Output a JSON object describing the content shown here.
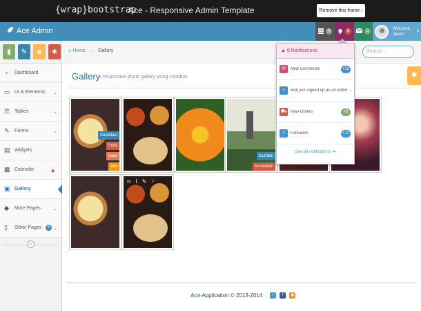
{
  "wrap_bar": {
    "logo": "{wrap}bootstrap",
    "title": "Ace - Responsive Admin Template",
    "remove_button": "Remove this frame ›"
  },
  "navbar": {
    "brand": "Ace Admin",
    "tasks_count": "4",
    "notifications_count": "8",
    "messages_count": "5",
    "user_greeting": "Welcome,",
    "user_name": "Jason"
  },
  "sidebar": {
    "items": [
      {
        "label": "Dashboard",
        "icon": "tachometer-icon"
      },
      {
        "label": "UI & Elements",
        "icon": "desktop-icon"
      },
      {
        "label": "Tables",
        "icon": "list-icon"
      },
      {
        "label": "Forms",
        "icon": "pencil-square-icon"
      },
      {
        "label": "Widgets",
        "icon": "list-alt-icon"
      },
      {
        "label": "Calendar",
        "icon": "calendar-icon"
      },
      {
        "label": "Gallery",
        "icon": "picture-icon"
      },
      {
        "label": "More Pages",
        "icon": "tag-icon"
      },
      {
        "label": "Other Pages",
        "icon": "file-icon",
        "badge": "5"
      }
    ]
  },
  "breadcrumb": {
    "home": "Home",
    "current": "Gallery",
    "search_placeholder": "Search ..."
  },
  "page": {
    "title": "Gallery",
    "subtitle": "» responsive photo gallery using colorbox"
  },
  "gallery": {
    "tags": [
      "breakfast",
      "fruits",
      "toast",
      "diet"
    ],
    "tags2": [
      "fountain",
      "recreation"
    ]
  },
  "notifications": {
    "header": "8 Notifications",
    "items": [
      {
        "label": "New Comments",
        "badge": "+12",
        "color": "#d6487e"
      },
      {
        "label": "Bob just signed up as an editor ...",
        "badge": "",
        "color": "#428bca"
      },
      {
        "label": "New Orders",
        "badge": "+8",
        "color": "#82af6f"
      },
      {
        "label": "Followers",
        "badge": "+11",
        "color": "#3b98d6"
      }
    ],
    "footer": "See all notifications ➔"
  },
  "footer": {
    "brand": "Ace",
    "text": "Application © 2013-2014"
  }
}
